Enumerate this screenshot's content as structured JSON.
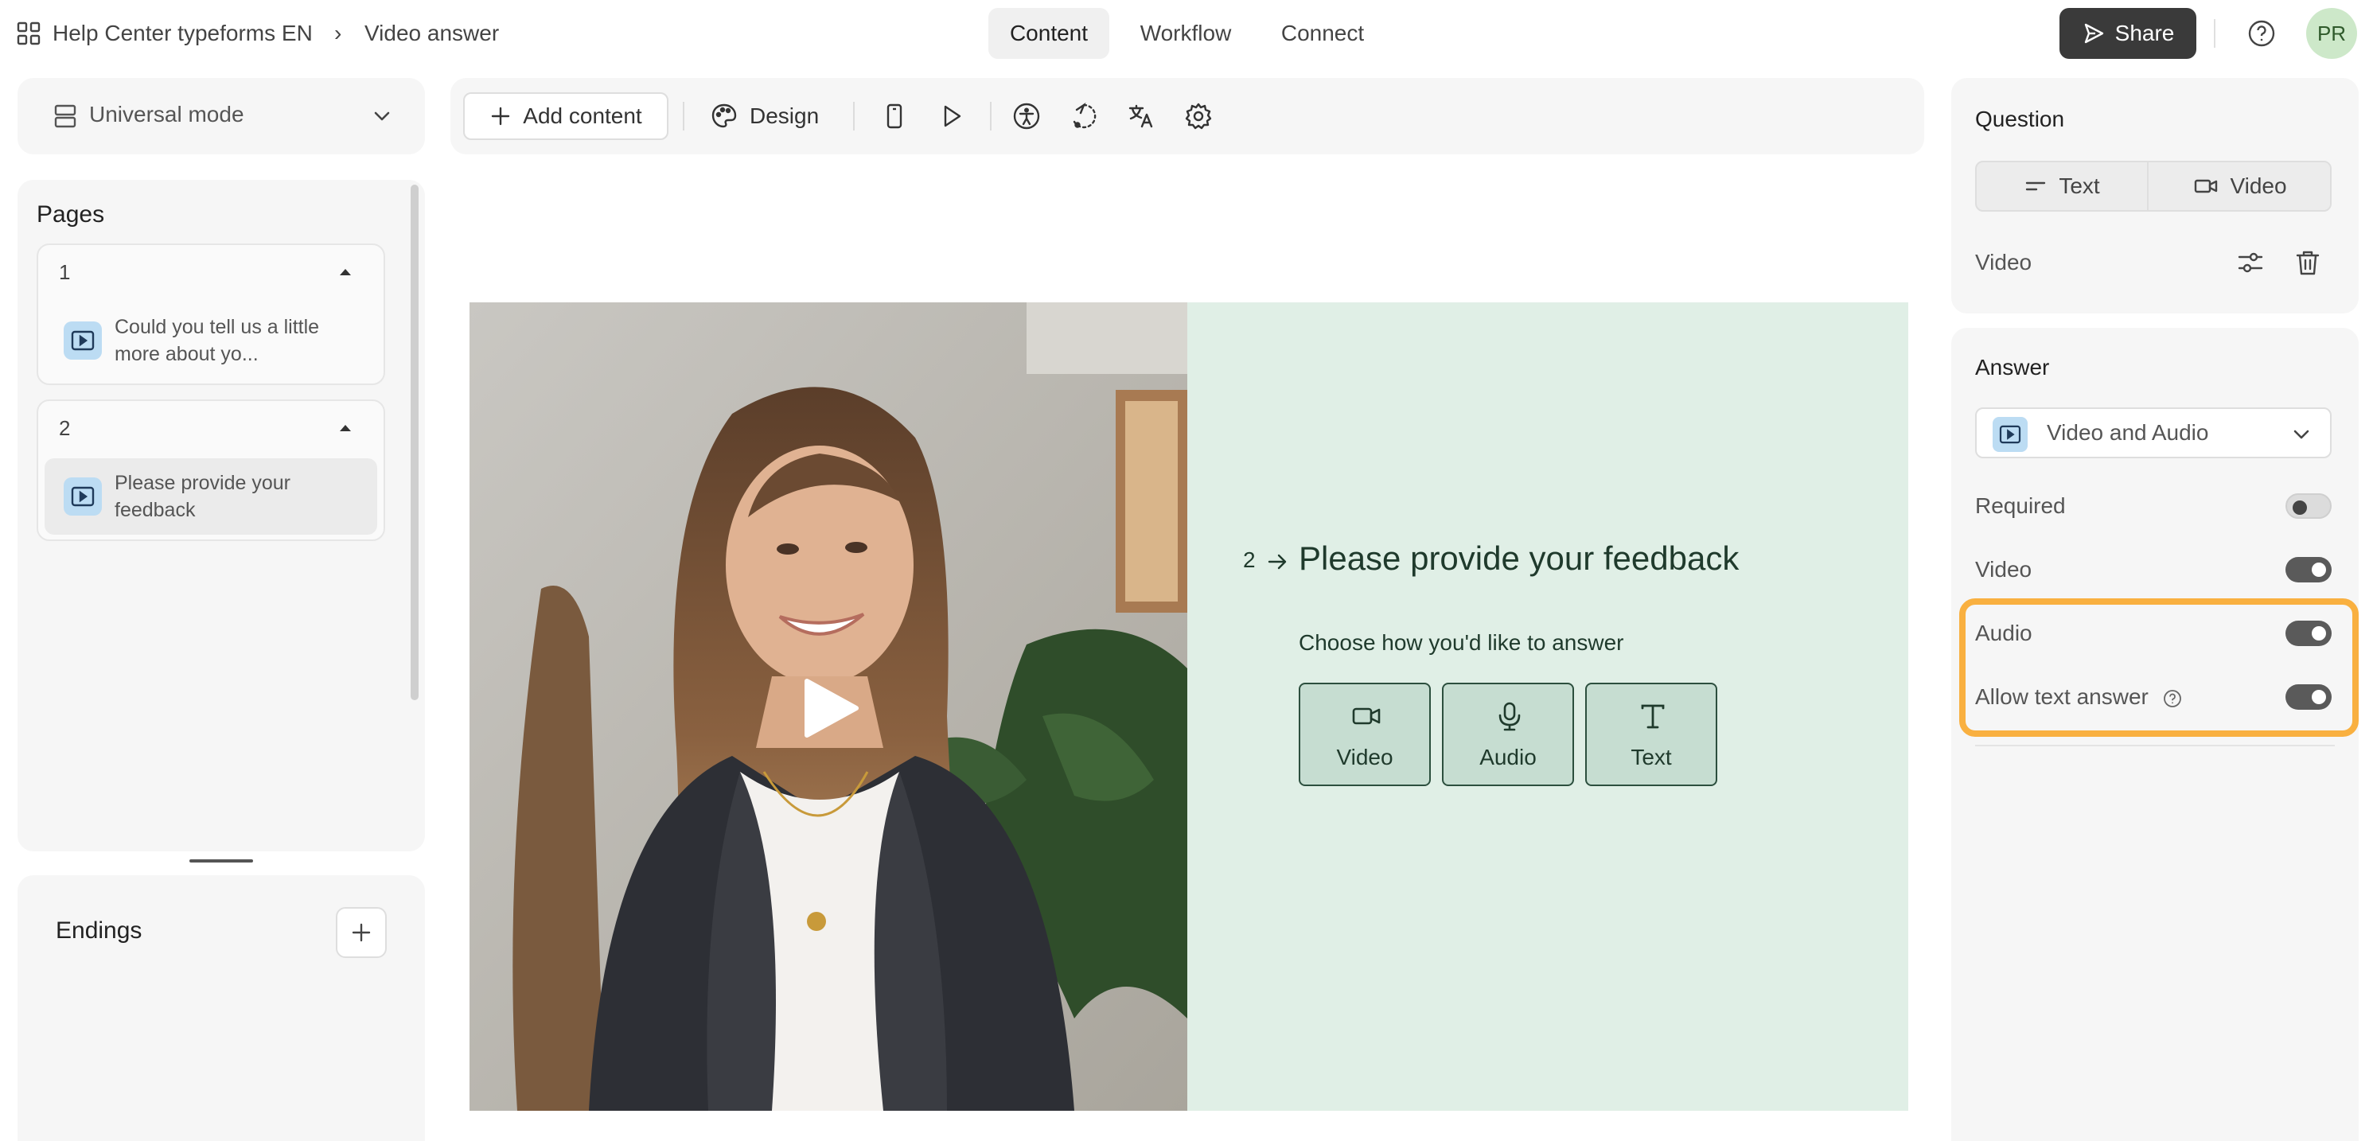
{
  "breadcrumb": {
    "workspace": "Help Center typeforms EN",
    "separator": "›",
    "form": "Video answer"
  },
  "top_tabs": [
    {
      "label": "Content",
      "active": true
    },
    {
      "label": "Workflow",
      "active": false
    },
    {
      "label": "Connect",
      "active": false
    }
  ],
  "share": {
    "label": "Share"
  },
  "user": {
    "initials": "PR"
  },
  "mode_select": {
    "label": "Universal mode"
  },
  "pages": {
    "title": "Pages",
    "groups": [
      {
        "number": "1",
        "item": {
          "text": "Could you tell us a little more about yo...",
          "selected": false
        }
      },
      {
        "number": "2",
        "item": {
          "text": "Please provide your feedback",
          "selected": true
        }
      }
    ]
  },
  "endings": {
    "title": "Endings"
  },
  "toolbar": {
    "add_content": "Add content",
    "design": "Design",
    "icons": [
      "mobile-preview-icon",
      "preview-play-icon",
      "accessibility-icon",
      "logic-icon",
      "translate-icon",
      "settings-icon"
    ]
  },
  "question": {
    "number": "2",
    "title": "Please provide your feedback",
    "subtitle": "Choose how you'd like to answer",
    "choices": [
      {
        "label": "Video",
        "icon": "video-camera-icon"
      },
      {
        "label": "Audio",
        "icon": "microphone-icon"
      },
      {
        "label": "Text",
        "icon": "text-t-icon"
      }
    ]
  },
  "question_panel": {
    "title": "Question",
    "segments": [
      {
        "label": "Text",
        "selected": false
      },
      {
        "label": "Video",
        "selected": true
      }
    ],
    "video_label": "Video"
  },
  "answer_panel": {
    "title": "Answer",
    "type": "Video and Audio",
    "toggles": [
      {
        "label": "Required",
        "on": false
      },
      {
        "label": "Video",
        "on": true
      },
      {
        "label": "Audio",
        "on": true
      },
      {
        "label": "Allow text answer",
        "on": true
      }
    ]
  },
  "colors": {
    "accent_dark": "#3a3a3a",
    "canvas_green": "#e0efe6",
    "choice_fill": "#c6ddd1",
    "highlight_orange": "#f9b040",
    "avatar_green": "#cde8c9"
  }
}
